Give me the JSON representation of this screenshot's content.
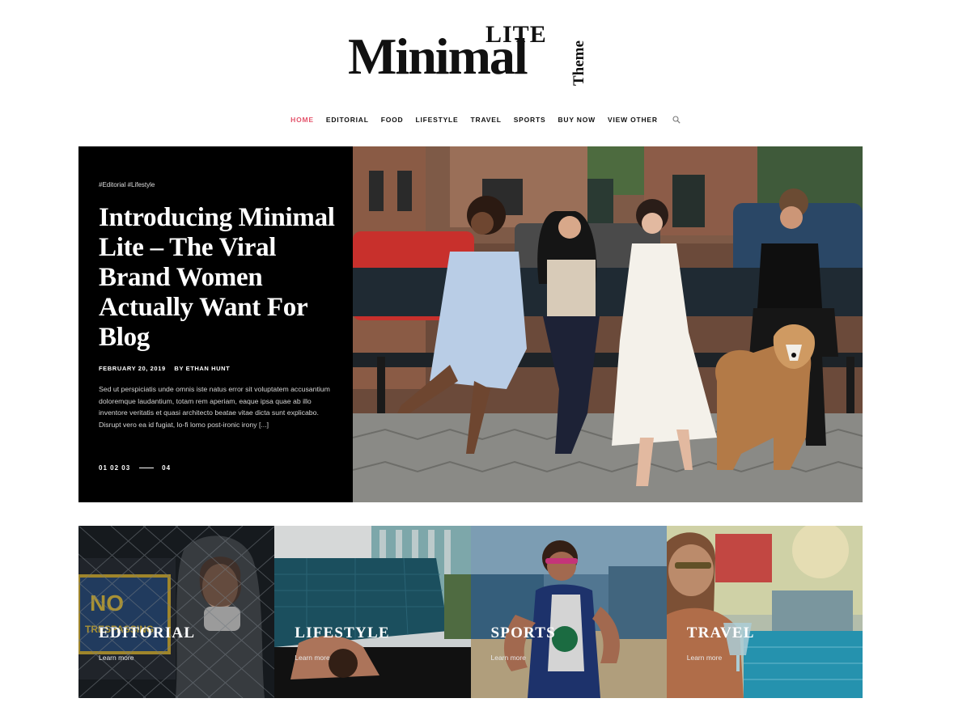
{
  "logo": {
    "main": "Minimal",
    "sup": "LITE",
    "side": "Theme"
  },
  "nav": {
    "items": [
      {
        "label": "HOME",
        "active": true
      },
      {
        "label": "EDITORIAL"
      },
      {
        "label": "FOOD"
      },
      {
        "label": "LIFESTYLE"
      },
      {
        "label": "TRAVEL"
      },
      {
        "label": "SPORTS"
      },
      {
        "label": "BUY NOW"
      },
      {
        "label": "VIEW OTHER"
      }
    ],
    "search_icon": "search-icon"
  },
  "hero": {
    "tags": "#Editorial #Lifestyle",
    "title": "Introducing Minimal Lite – The Viral Brand Women Actually Want For Blog",
    "date": "FEBRUARY 20, 2019",
    "author": "BY ETHAN HUNT",
    "excerpt": "Sed ut perspiciatis unde omnis iste natus error sit voluptatem accusantium doloremque laudantium, totam rem aperiam, eaque ipsa quae ab illo inventore veritatis et quasi architecto beatae vitae dicta sunt explicabo. Disrupt vero ea id fugiat, lo-fi lomo post-ironic irony [...]",
    "pager_pages": "01 02 03",
    "pager_last": "04"
  },
  "categories": [
    {
      "title": "EDITORIAL",
      "link": "Learn more"
    },
    {
      "title": "LIFESTYLE",
      "link": "Learn more"
    },
    {
      "title": "SPORTS",
      "link": "Learn more"
    },
    {
      "title": "TRAVEL",
      "link": "Learn more"
    }
  ],
  "colors": {
    "accent": "#e4536b",
    "panel": "#000000"
  }
}
